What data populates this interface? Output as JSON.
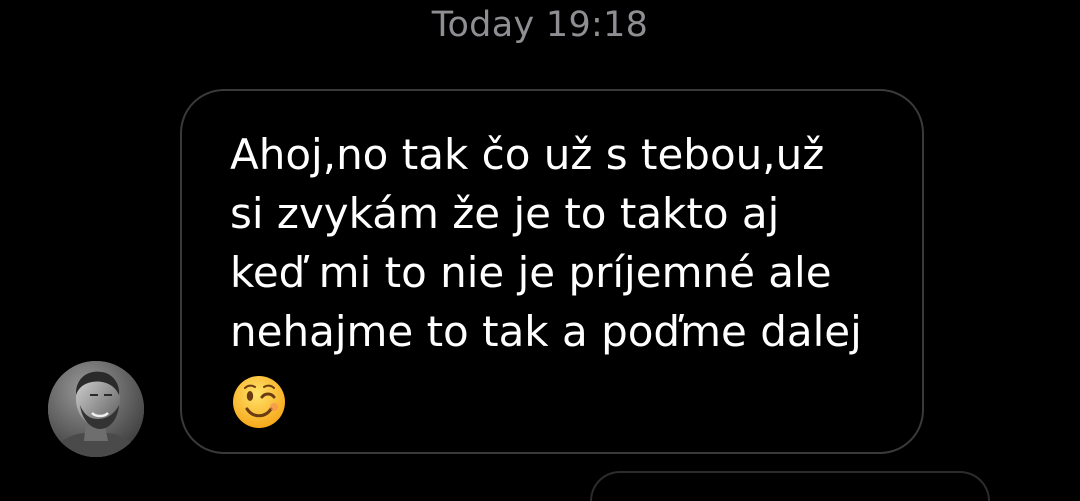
{
  "chat": {
    "timestamp": "Today 19:18",
    "messages": [
      {
        "sender": "incoming",
        "text": "Ahoj,no tak čo už s tebou,už\nsi zvykám že je to takto aj\nkeď mi to nie je príjemné ale\nnehajme to tak a poďme dalej",
        "emoji_icon": "winking-face-emoji"
      }
    ],
    "avatar_icon": "contact-avatar"
  },
  "colors": {
    "background": "#000000",
    "timestamp": "#8e8e93",
    "bubble_border": "#3a3a3c",
    "message_text": "#ffffff",
    "emoji_face": "#ffc83d"
  }
}
